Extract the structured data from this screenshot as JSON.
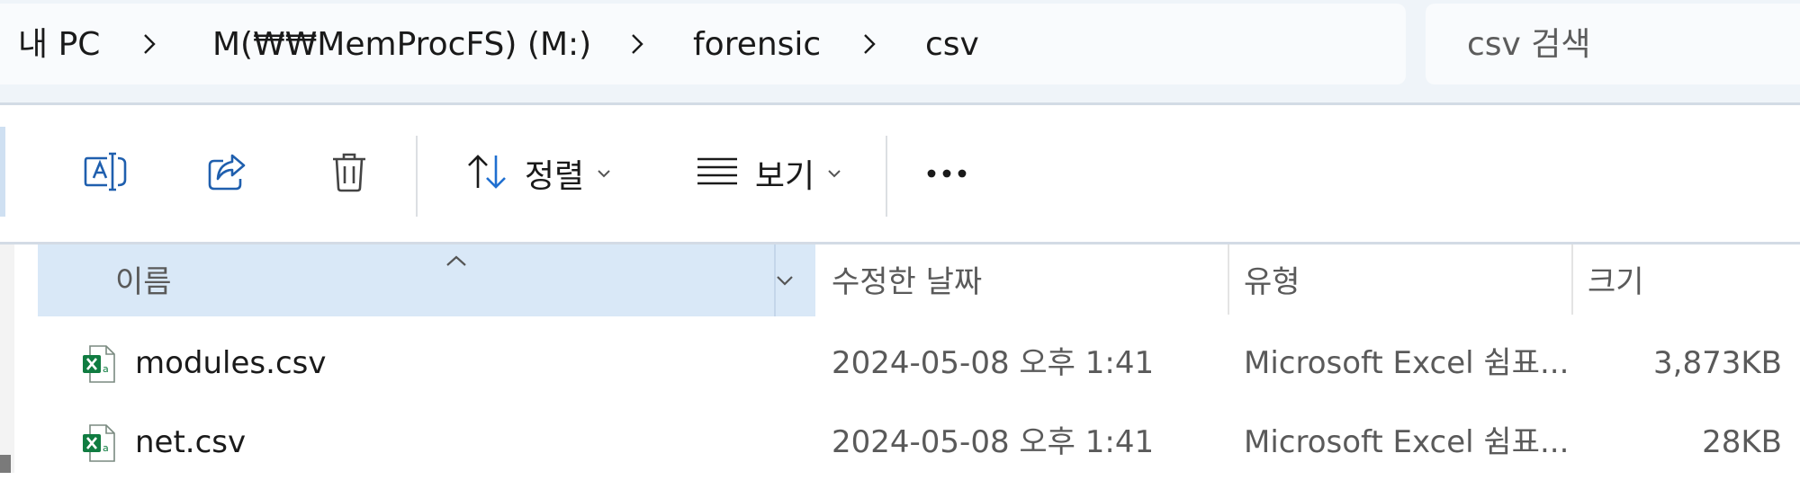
{
  "breadcrumb": {
    "items": [
      "내 PC",
      "M(₩₩MemProcFS) (M:)",
      "forensic",
      "csv"
    ]
  },
  "search": {
    "placeholder": "csv 검색",
    "value": ""
  },
  "toolbar": {
    "sort_label": "정렬",
    "view_label": "보기",
    "more_label": "•••",
    "icons": [
      "rename-icon",
      "share-icon",
      "delete-icon",
      "sort-icon",
      "view-icon",
      "more-icon"
    ]
  },
  "columns": {
    "name": "이름",
    "modified": "수정한 날짜",
    "type": "유형",
    "size": "크기",
    "sorted_by": "name"
  },
  "files": [
    {
      "name": "modules.csv",
      "modified": "2024-05-08 오후 1:41",
      "type": "Microsoft Excel 쉼표...",
      "size": "3,873KB",
      "icon": "excel-csv-icon"
    },
    {
      "name": "net.csv",
      "modified": "2024-05-08 오후 1:41",
      "type": "Microsoft Excel 쉼표...",
      "size": "28KB",
      "icon": "excel-csv-icon"
    }
  ],
  "colors": {
    "header_bg": "#eff4f9",
    "selected_column_bg": "#d9e8f7",
    "accent": "#005fb8",
    "excel_green": "#107c41"
  }
}
